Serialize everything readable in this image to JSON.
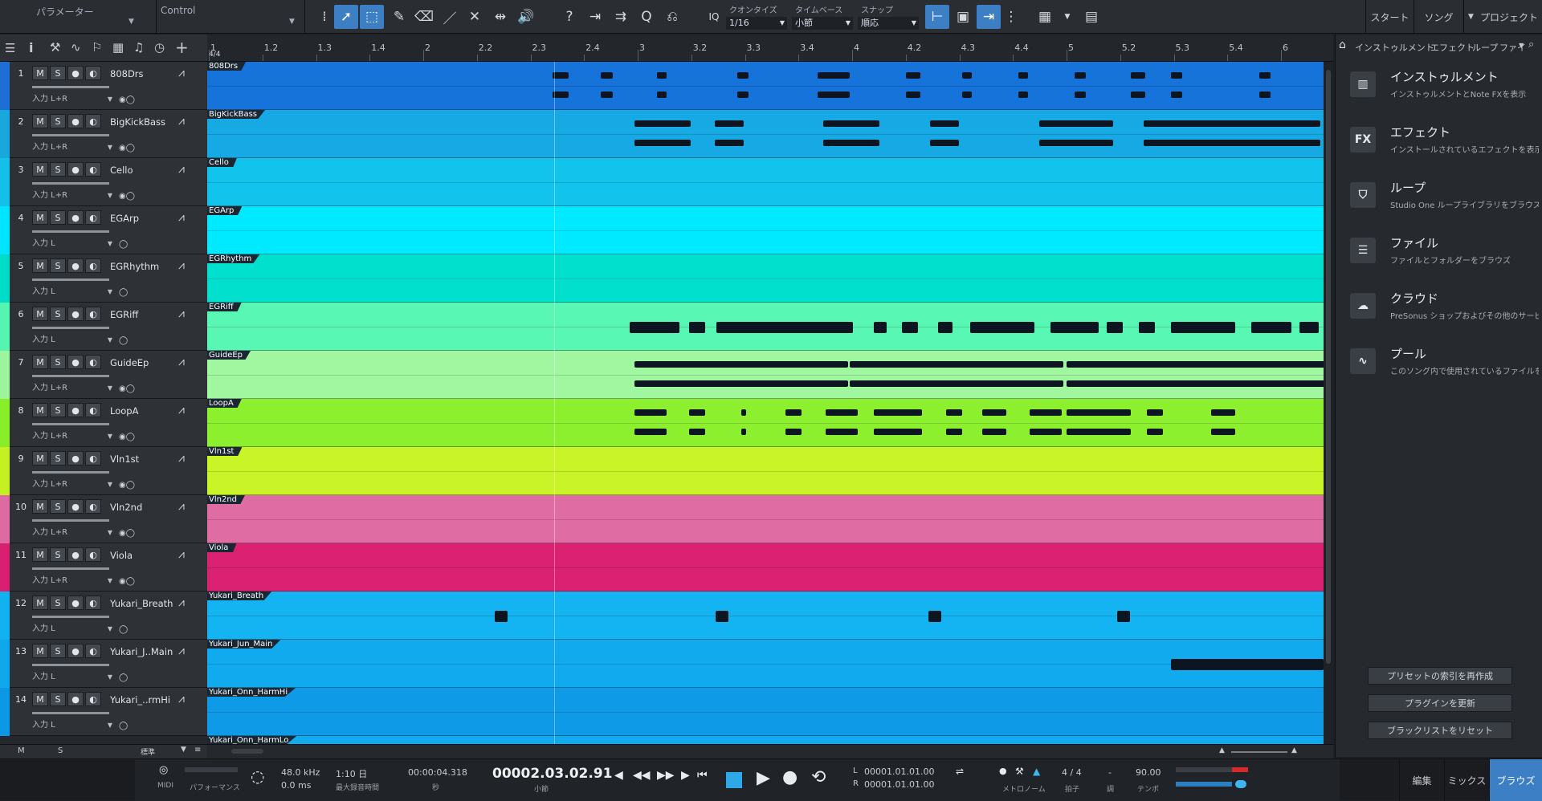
{
  "toolbar": {
    "param_label": "パラメーター",
    "control_label": "Control",
    "quantize_label": "クオンタイズ",
    "quantize_value": "1/16",
    "timebase_label": "タイムベース",
    "timebase_value": "小節",
    "snap_label": "スナップ",
    "snap_value": "順応",
    "iq_label": "IQ",
    "nav": [
      "スタート",
      "ソング",
      "プロジェクト"
    ]
  },
  "ruler": {
    "signature": "4/4",
    "ticks": [
      "1",
      "1.2",
      "1.3",
      "1.4",
      "2",
      "2.2",
      "2.3",
      "2.4",
      "3",
      "3.2",
      "3.3",
      "3.4",
      "4",
      "4.2",
      "4.3",
      "4.4",
      "5",
      "5.2",
      "5.3",
      "5.4",
      "6"
    ]
  },
  "tracks": [
    {
      "num": "1",
      "name": "808Drs",
      "input": "入力 L+R",
      "color": "#1d6fd6",
      "lane_color": "#1573d9"
    },
    {
      "num": "2",
      "name": "BigKickBass",
      "input": "入力 L+R",
      "color": "#1aa7dd",
      "lane_color": "#17a9e4"
    },
    {
      "num": "3",
      "name": "Cello",
      "input": "入力 L+R",
      "color": "#14c0e8",
      "lane_color": "#12c3ec"
    },
    {
      "num": "4",
      "name": "EGArp",
      "input": "入力 L",
      "color": "#00e5ff",
      "lane_color": "#00eaff"
    },
    {
      "num": "5",
      "name": "EGRhythm",
      "input": "入力 L",
      "color": "#00dcc8",
      "lane_color": "#00e0cc"
    },
    {
      "num": "6",
      "name": "EGRiff",
      "input": "入力 L",
      "color": "#55f5b0",
      "lane_color": "#58f7b4"
    },
    {
      "num": "7",
      "name": "GuideEp",
      "input": "入力 L+R",
      "color": "#9cf59c",
      "lane_color": "#a0f7a0"
    },
    {
      "num": "8",
      "name": "LoopA",
      "input": "入力 L+R",
      "color": "#8aed2a",
      "lane_color": "#8cf02e"
    },
    {
      "num": "9",
      "name": "Vln1st",
      "input": "入力 L+R",
      "color": "#c5f024",
      "lane_color": "#c8f428"
    },
    {
      "num": "10",
      "name": "Vln2nd",
      "input": "入力 L+R",
      "color": "#dd6aa0",
      "lane_color": "#df6ca2"
    },
    {
      "num": "11",
      "name": "Viola",
      "input": "入力 L+R",
      "color": "#d91f70",
      "lane_color": "#db2272"
    },
    {
      "num": "12",
      "name": "Yukari_Breath",
      "input": "入力 L",
      "color": "#12b2f0",
      "lane_color": "#14b4f2"
    },
    {
      "num": "13",
      "name": "Yukari_J..Main",
      "input": "入力 L",
      "color": "#0fa8ec",
      "lane_color": "#11aaee"
    },
    {
      "num": "14",
      "name": "Yukari_..rmHi",
      "input": "入力 L",
      "color": "#0d98e6",
      "lane_color": "#0f9ae8"
    }
  ],
  "lanes": [
    "808Drs",
    "BigKickBass",
    "Cello",
    "EGArp",
    "EGRhythm",
    "EGRiff",
    "GuideEp",
    "LoopA",
    "Vln1st",
    "Vln2nd",
    "Viola",
    "Yukari_Breath",
    "Yukari_Jun_Main",
    "Yukari_Onn_HarmHi",
    "Yukari_Onn_HarmLo"
  ],
  "track_buttons": {
    "mute": "M",
    "solo": "S"
  },
  "browser": {
    "tabs": [
      "インストゥルメント",
      "エフェクト",
      "ループ",
      "ファイ"
    ],
    "items": [
      {
        "icon": "piano-icon",
        "title": "インストゥルメント",
        "sub": "インストゥルメントとNote FXを表示"
      },
      {
        "icon": "fx-icon",
        "title": "エフェクト",
        "sub": "インストールされているエフェクトを表示"
      },
      {
        "icon": "loop-icon",
        "title": "ループ",
        "sub": "Studio One ループライブラリをブラウズ"
      },
      {
        "icon": "file-icon",
        "title": "ファイル",
        "sub": "ファイルとフォルダーをブラウズ"
      },
      {
        "icon": "cloud-icon",
        "title": "クラウド",
        "sub": "PreSonus ショップおよびその他のサービ"
      },
      {
        "icon": "pool-icon",
        "title": "プール",
        "sub": "このソング内で使用されているファイルを表"
      }
    ],
    "buttons": [
      "プリセットの索引を再作成",
      "プラグインを更新",
      "ブラックリストをリセット"
    ]
  },
  "bottom_left": {
    "m": "M",
    "s": "S",
    "view": "標準"
  },
  "transport": {
    "midi": "MIDI",
    "performance": "パフォーマンス",
    "sample_rate": "48.0 kHz",
    "latency": "0.0 ms",
    "record_time": "1:10 日",
    "record_time_label": "最大録音時間",
    "seconds": "00:00:04.318",
    "seconds_label": "秒",
    "bars": "00002.03.02.91",
    "bars_label": "小節",
    "loop_l_label": "L",
    "loop_l": "00001.01.01.00",
    "loop_r_label": "R",
    "loop_r": "00001.01.01.00",
    "metronome": "メトロノーム",
    "signature": "4 / 4",
    "signature_label": "拍子",
    "key": "-",
    "key_label": "調",
    "tempo": "90.00",
    "tempo_label": "テンポ",
    "nav": [
      "編集",
      "ミックス",
      "ブラウズ"
    ],
    "accent": "#3d7fc4"
  }
}
